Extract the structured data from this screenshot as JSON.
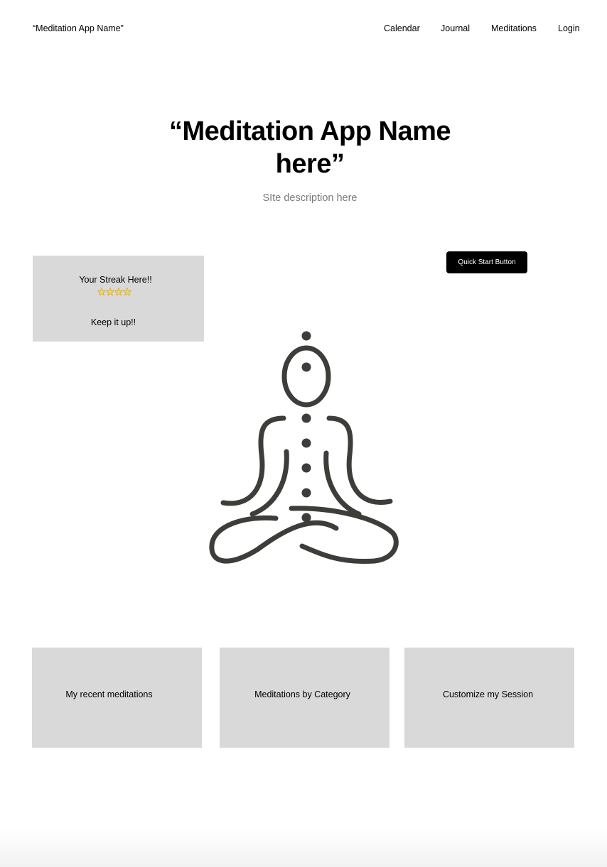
{
  "header": {
    "brand": "“Meditation App Name”",
    "nav": [
      "Calendar",
      "Journal",
      "Meditations",
      "Login"
    ]
  },
  "hero": {
    "title_line1": "“Meditation App Name",
    "title_line2": "here”",
    "subtitle": "SIte description here"
  },
  "streak": {
    "title": "Your Streak Here!!",
    "star_count": 4,
    "message": "Keep it up!!",
    "star_icon": "star-icon"
  },
  "quick_start": {
    "label": "Quick Start Button"
  },
  "illustration": {
    "icon": "meditation-figure-icon",
    "color": "#3d3d3a"
  },
  "cards": [
    {
      "label": "My recent meditations"
    },
    {
      "label": "Meditations by Category"
    },
    {
      "label": "Customize my Session"
    }
  ],
  "colors": {
    "card_bg": "#d9d9d9",
    "button_bg": "#000000",
    "subtitle": "#7a7a7a"
  }
}
